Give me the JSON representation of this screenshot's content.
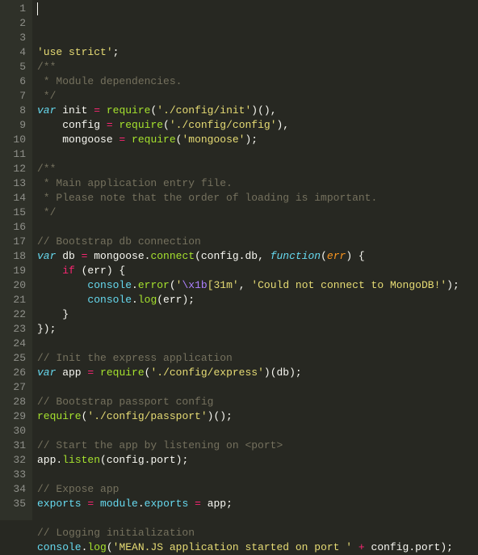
{
  "lines": [
    {
      "n": "1",
      "tokens": [
        {
          "c": "s-str",
          "t": "'use strict'"
        },
        {
          "c": "s-plain",
          "t": ";"
        }
      ]
    },
    {
      "n": "2",
      "tokens": [
        {
          "c": "s-comment",
          "t": "/**"
        }
      ]
    },
    {
      "n": "3",
      "tokens": [
        {
          "c": "s-comment",
          "t": " * Module dependencies."
        }
      ]
    },
    {
      "n": "4",
      "tokens": [
        {
          "c": "s-comment",
          "t": " */"
        }
      ]
    },
    {
      "n": "5",
      "tokens": [
        {
          "c": "s-kw",
          "t": "var"
        },
        {
          "c": "s-plain",
          "t": " init "
        },
        {
          "c": "s-op",
          "t": "="
        },
        {
          "c": "s-plain",
          "t": " "
        },
        {
          "c": "s-func",
          "t": "require"
        },
        {
          "c": "s-plain",
          "t": "("
        },
        {
          "c": "s-str",
          "t": "'./config/init'"
        },
        {
          "c": "s-plain",
          "t": ")(),"
        }
      ]
    },
    {
      "n": "6",
      "tokens": [
        {
          "c": "s-plain",
          "t": "    config "
        },
        {
          "c": "s-op",
          "t": "="
        },
        {
          "c": "s-plain",
          "t": " "
        },
        {
          "c": "s-func",
          "t": "require"
        },
        {
          "c": "s-plain",
          "t": "("
        },
        {
          "c": "s-str",
          "t": "'./config/config'"
        },
        {
          "c": "s-plain",
          "t": "),"
        }
      ]
    },
    {
      "n": "7",
      "tokens": [
        {
          "c": "s-plain",
          "t": "    mongoose "
        },
        {
          "c": "s-op",
          "t": "="
        },
        {
          "c": "s-plain",
          "t": " "
        },
        {
          "c": "s-func",
          "t": "require"
        },
        {
          "c": "s-plain",
          "t": "("
        },
        {
          "c": "s-str",
          "t": "'mongoose'"
        },
        {
          "c": "s-plain",
          "t": ");"
        }
      ]
    },
    {
      "n": "8",
      "tokens": []
    },
    {
      "n": "9",
      "tokens": [
        {
          "c": "s-comment",
          "t": "/**"
        }
      ]
    },
    {
      "n": "10",
      "tokens": [
        {
          "c": "s-comment",
          "t": " * Main application entry file."
        }
      ]
    },
    {
      "n": "11",
      "tokens": [
        {
          "c": "s-comment",
          "t": " * Please note that the order of loading is important."
        }
      ]
    },
    {
      "n": "12",
      "tokens": [
        {
          "c": "s-comment",
          "t": " */"
        }
      ]
    },
    {
      "n": "13",
      "tokens": []
    },
    {
      "n": "14",
      "tokens": [
        {
          "c": "s-comment",
          "t": "// Bootstrap db connection"
        }
      ]
    },
    {
      "n": "15",
      "tokens": [
        {
          "c": "s-kw",
          "t": "var"
        },
        {
          "c": "s-plain",
          "t": " db "
        },
        {
          "c": "s-op",
          "t": "="
        },
        {
          "c": "s-plain",
          "t": " mongoose."
        },
        {
          "c": "s-func",
          "t": "connect"
        },
        {
          "c": "s-plain",
          "t": "(config.db, "
        },
        {
          "c": "s-kw",
          "t": "function"
        },
        {
          "c": "s-plain",
          "t": "("
        },
        {
          "c": "s-param",
          "t": "err"
        },
        {
          "c": "s-plain",
          "t": ") {"
        }
      ]
    },
    {
      "n": "16",
      "tokens": [
        {
          "c": "s-plain",
          "t": "    "
        },
        {
          "c": "s-storage",
          "t": "if"
        },
        {
          "c": "s-plain",
          "t": " (err) {"
        }
      ]
    },
    {
      "n": "17",
      "tokens": [
        {
          "c": "s-plain",
          "t": "        "
        },
        {
          "c": "s-support",
          "t": "console"
        },
        {
          "c": "s-plain",
          "t": "."
        },
        {
          "c": "s-func",
          "t": "error"
        },
        {
          "c": "s-plain",
          "t": "("
        },
        {
          "c": "s-str",
          "t": "'"
        },
        {
          "c": "s-const",
          "t": "\\x1b"
        },
        {
          "c": "s-str",
          "t": "[31m'"
        },
        {
          "c": "s-plain",
          "t": ", "
        },
        {
          "c": "s-str",
          "t": "'Could not connect to MongoDB!'"
        },
        {
          "c": "s-plain",
          "t": ");"
        }
      ]
    },
    {
      "n": "18",
      "tokens": [
        {
          "c": "s-plain",
          "t": "        "
        },
        {
          "c": "s-support",
          "t": "console"
        },
        {
          "c": "s-plain",
          "t": "."
        },
        {
          "c": "s-func",
          "t": "log"
        },
        {
          "c": "s-plain",
          "t": "(err);"
        }
      ]
    },
    {
      "n": "19",
      "tokens": [
        {
          "c": "s-plain",
          "t": "    }"
        }
      ]
    },
    {
      "n": "20",
      "tokens": [
        {
          "c": "s-plain",
          "t": "});"
        }
      ]
    },
    {
      "n": "21",
      "tokens": []
    },
    {
      "n": "22",
      "tokens": [
        {
          "c": "s-comment",
          "t": "// Init the express application"
        }
      ]
    },
    {
      "n": "23",
      "tokens": [
        {
          "c": "s-kw",
          "t": "var"
        },
        {
          "c": "s-plain",
          "t": " app "
        },
        {
          "c": "s-op",
          "t": "="
        },
        {
          "c": "s-plain",
          "t": " "
        },
        {
          "c": "s-func",
          "t": "require"
        },
        {
          "c": "s-plain",
          "t": "("
        },
        {
          "c": "s-str",
          "t": "'./config/express'"
        },
        {
          "c": "s-plain",
          "t": ")(db);"
        }
      ]
    },
    {
      "n": "24",
      "tokens": []
    },
    {
      "n": "25",
      "tokens": [
        {
          "c": "s-comment",
          "t": "// Bootstrap passport config"
        }
      ]
    },
    {
      "n": "26",
      "tokens": [
        {
          "c": "s-func",
          "t": "require"
        },
        {
          "c": "s-plain",
          "t": "("
        },
        {
          "c": "s-str",
          "t": "'./config/passport'"
        },
        {
          "c": "s-plain",
          "t": ")();"
        }
      ]
    },
    {
      "n": "27",
      "tokens": []
    },
    {
      "n": "28",
      "tokens": [
        {
          "c": "s-comment",
          "t": "// Start the app by listening on <port>"
        }
      ]
    },
    {
      "n": "29",
      "tokens": [
        {
          "c": "s-plain",
          "t": "app."
        },
        {
          "c": "s-func",
          "t": "listen"
        },
        {
          "c": "s-plain",
          "t": "(config.port);"
        }
      ]
    },
    {
      "n": "30",
      "tokens": []
    },
    {
      "n": "31",
      "tokens": [
        {
          "c": "s-comment",
          "t": "// Expose app"
        }
      ]
    },
    {
      "n": "32",
      "tokens": [
        {
          "c": "s-support",
          "t": "exports"
        },
        {
          "c": "s-plain",
          "t": " "
        },
        {
          "c": "s-op",
          "t": "="
        },
        {
          "c": "s-plain",
          "t": " "
        },
        {
          "c": "s-support",
          "t": "module"
        },
        {
          "c": "s-plain",
          "t": "."
        },
        {
          "c": "s-support",
          "t": "exports"
        },
        {
          "c": "s-plain",
          "t": " "
        },
        {
          "c": "s-op",
          "t": "="
        },
        {
          "c": "s-plain",
          "t": " app;"
        }
      ]
    },
    {
      "n": "33",
      "tokens": []
    },
    {
      "n": "34",
      "tokens": [
        {
          "c": "s-comment",
          "t": "// Logging initialization"
        }
      ]
    },
    {
      "n": "35",
      "tokens": [
        {
          "c": "s-support",
          "t": "console"
        },
        {
          "c": "s-plain",
          "t": "."
        },
        {
          "c": "s-func",
          "t": "log"
        },
        {
          "c": "s-plain",
          "t": "("
        },
        {
          "c": "s-str",
          "t": "'MEAN.JS application started on port '"
        },
        {
          "c": "s-plain",
          "t": " "
        },
        {
          "c": "s-op",
          "t": "+"
        },
        {
          "c": "s-plain",
          "t": " config.port);"
        }
      ]
    }
  ]
}
